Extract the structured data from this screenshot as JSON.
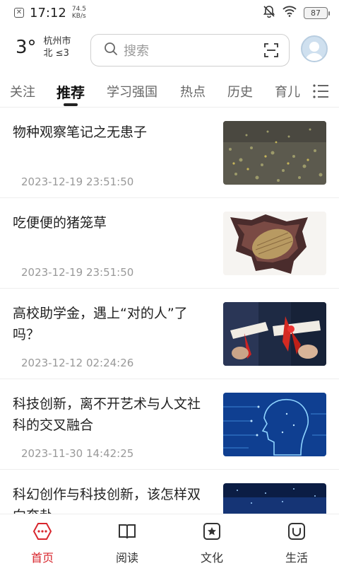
{
  "status_bar": {
    "time": "17:12",
    "net_speed_value": "74.5",
    "net_speed_unit": "KB/s",
    "battery": "87",
    "icons": [
      "close-icon",
      "mute-icon",
      "wifi-icon",
      "battery-icon"
    ]
  },
  "weather": {
    "temperature": "3°",
    "city": "杭州市",
    "wind": "北 ≤3"
  },
  "search": {
    "placeholder": "搜索"
  },
  "tabs": [
    {
      "label": "关注"
    },
    {
      "label": "推荐",
      "active": true
    },
    {
      "label": "学习强国"
    },
    {
      "label": "热点"
    },
    {
      "label": "历史"
    },
    {
      "label": "育儿"
    }
  ],
  "feed": [
    {
      "title": "物种观察笔记之无患子",
      "time": "2023-12-19 23:51:50",
      "thumb": "fallen-leaves-photo"
    },
    {
      "title": "吃便便的猪笼草",
      "time": "2023-12-19 23:51:50",
      "thumb": "pitcher-plant-illustration"
    },
    {
      "title": "高校助学金，遇上“对的人”了吗？",
      "time": "2023-12-12 02:24:26",
      "thumb": "graduation-diploma-photo"
    },
    {
      "title": "科技创新，离不开艺术与人文社科的交叉融合",
      "time": "2023-11-30 14:42:25",
      "thumb": "digital-head-illustration"
    },
    {
      "title": "科幻创作与科技创新，该怎样双向奔赴",
      "time": "",
      "thumb": "blue-tech-background"
    }
  ],
  "bottom_nav": [
    {
      "label": "首页",
      "icon": "home-icon",
      "active": true
    },
    {
      "label": "阅读",
      "icon": "book-icon"
    },
    {
      "label": "文化",
      "icon": "culture-star-icon"
    },
    {
      "label": "生活",
      "icon": "life-icon"
    }
  ],
  "colors": {
    "accent": "#d8262d",
    "text": "#222222",
    "muted": "#999999"
  }
}
